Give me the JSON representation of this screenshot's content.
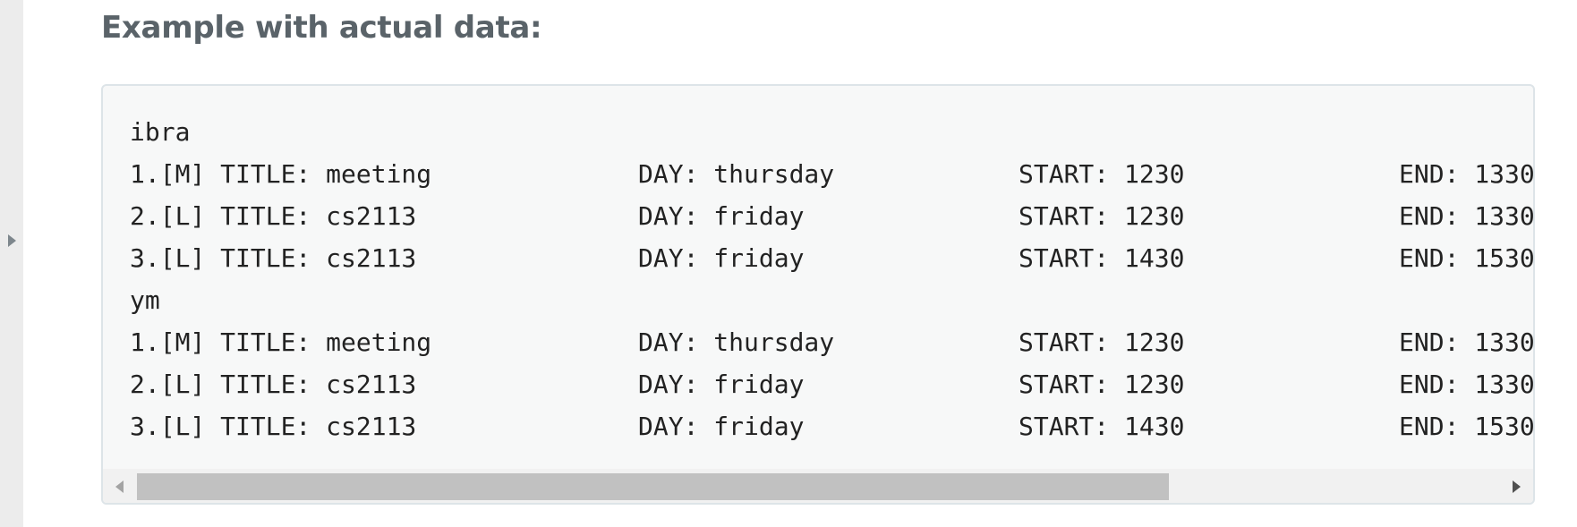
{
  "heading": "Example with actual data:",
  "code_block": {
    "lines": [
      {
        "c1": "ibra",
        "c2": "",
        "c3": "",
        "c4": ""
      },
      {
        "c1": "1.[M] TITLE: meeting",
        "c2": "DAY: thursday",
        "c3": "START: 1230",
        "c4": "END: 1330"
      },
      {
        "c1": "2.[L] TITLE: cs2113",
        "c2": "DAY: friday",
        "c3": "START: 1230",
        "c4": "END: 1330"
      },
      {
        "c1": "3.[L] TITLE: cs2113",
        "c2": "DAY: friday",
        "c3": "START: 1430",
        "c4": "END: 1530"
      },
      {
        "c1": "ym",
        "c2": "",
        "c3": "",
        "c4": ""
      },
      {
        "c1": "1.[M] TITLE: meeting",
        "c2": "DAY: thursday",
        "c3": "START: 1230",
        "c4": "END: 1330"
      },
      {
        "c1": "2.[L] TITLE: cs2113",
        "c2": "DAY: friday",
        "c3": "START: 1230",
        "c4": "END: 1330"
      },
      {
        "c1": "3.[L] TITLE: cs2113",
        "c2": "DAY: friday",
        "c3": "START: 1430",
        "c4": "END: 1530"
      }
    ]
  },
  "scrollbar": {
    "left_icon": "triangle-left-icon",
    "right_icon": "triangle-right-icon",
    "visible_fraction": 0.72,
    "scroll_position": 0.0
  },
  "sidebar_toggle_icon": "triangle-right-icon",
  "colors": {
    "heading": "#5a6369",
    "code_text": "#222222",
    "panel_background": "#f7f8f8",
    "panel_border": "#dde4e8",
    "scroll_thumb": "#c1c1c1"
  }
}
